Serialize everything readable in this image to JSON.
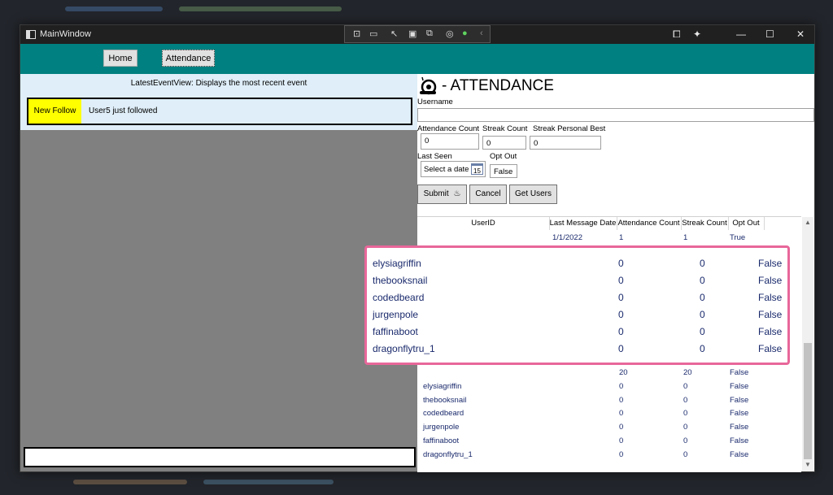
{
  "window": {
    "title": "MainWindow"
  },
  "toolbar": {
    "home_label": "Home",
    "attendance_label": "Attendance"
  },
  "latest_event": {
    "title": "LatestEventView: Displays the most recent event",
    "badge": "New Follow",
    "message": "User5 just followed"
  },
  "attendance": {
    "heading": "- ATTENDANCE",
    "username_label": "Username",
    "username_value": "",
    "attendance_count_label": "Attendance Count",
    "attendance_count_value": "0",
    "streak_count_label": "Streak Count",
    "streak_count_value": "0",
    "streak_best_label": "Streak Personal Best",
    "streak_best_value": "0",
    "last_seen_label": "Last Seen",
    "last_seen_placeholder": "Select a date",
    "calendar_day": "15",
    "opt_out_label": "Opt Out",
    "opt_out_value": "False",
    "submit_label": "Submit",
    "cancel_label": "Cancel",
    "get_users_label": "Get Users"
  },
  "grid": {
    "columns": [
      "UserID",
      "Last Message Date",
      "Attendance Count",
      "Streak Count",
      "Opt Out"
    ],
    "first_row": {
      "last_message": "1/1/2022",
      "attendance": "1",
      "streak": "1",
      "opt_out": "True"
    },
    "mid_row": {
      "attendance": "20",
      "streak": "20",
      "opt_out": "False"
    },
    "rows": [
      {
        "user": "elysiagriffin",
        "attendance": "0",
        "streak": "0",
        "opt_out": "False"
      },
      {
        "user": "thebooksnail",
        "attendance": "0",
        "streak": "0",
        "opt_out": "False"
      },
      {
        "user": "codedbeard",
        "attendance": "0",
        "streak": "0",
        "opt_out": "False"
      },
      {
        "user": "jurgenpole",
        "attendance": "0",
        "streak": "0",
        "opt_out": "False"
      },
      {
        "user": "faffinaboot",
        "attendance": "0",
        "streak": "0",
        "opt_out": "False"
      },
      {
        "user": "dragonflytru_1",
        "attendance": "0",
        "streak": "0",
        "opt_out": "False"
      }
    ]
  },
  "zoom_rows": [
    {
      "user": "elysiagriffin",
      "attendance": "0",
      "streak": "0",
      "opt_out": "False"
    },
    {
      "user": "thebooksnail",
      "attendance": "0",
      "streak": "0",
      "opt_out": "False"
    },
    {
      "user": "codedbeard",
      "attendance": "0",
      "streak": "0",
      "opt_out": "False"
    },
    {
      "user": "jurgenpole",
      "attendance": "0",
      "streak": "0",
      "opt_out": "False"
    },
    {
      "user": "faffinaboot",
      "attendance": "0",
      "streak": "0",
      "opt_out": "False"
    },
    {
      "user": "dragonflytru_1",
      "attendance": "0",
      "streak": "0",
      "opt_out": "False"
    }
  ],
  "colors": {
    "toolbar": "#008080",
    "badge": "#ffff00",
    "highlight_border": "#e8679a"
  }
}
